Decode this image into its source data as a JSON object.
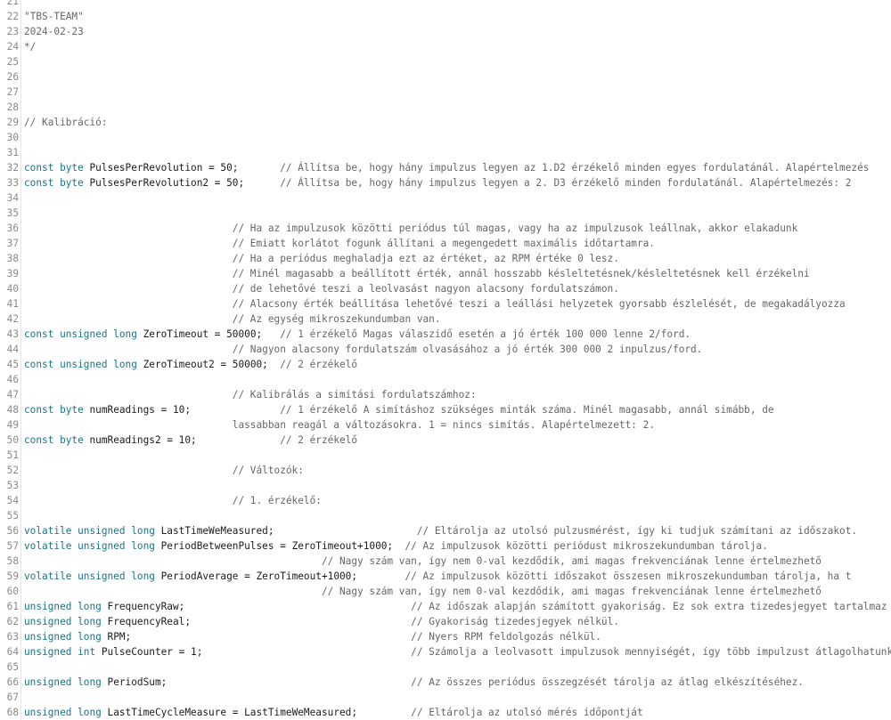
{
  "editor": {
    "lines": [
      {
        "n": "21",
        "segs": []
      },
      {
        "n": "22",
        "segs": [
          {
            "t": "cm",
            "v": "\"TBS-TEAM\""
          }
        ]
      },
      {
        "n": "23",
        "segs": [
          {
            "t": "cm",
            "v": "2024-02-23"
          }
        ]
      },
      {
        "n": "24",
        "segs": [
          {
            "t": "cm",
            "v": "*/"
          }
        ]
      },
      {
        "n": "25",
        "segs": []
      },
      {
        "n": "26",
        "segs": []
      },
      {
        "n": "27",
        "segs": []
      },
      {
        "n": "28",
        "segs": []
      },
      {
        "n": "29",
        "segs": [
          {
            "t": "cm",
            "v": "// Kalibráció:"
          }
        ]
      },
      {
        "n": "30",
        "segs": []
      },
      {
        "n": "31",
        "segs": []
      },
      {
        "n": "32",
        "segs": [
          {
            "t": "kw",
            "v": "const byte "
          },
          {
            "t": "id",
            "v": "PulsesPerRevolution = 50;       "
          },
          {
            "t": "cm",
            "v": "// Állítsa be, hogy hány impulzus legyen az 1.D2 érzékelő minden egyes fordulatánál. Alapértelmezés"
          }
        ]
      },
      {
        "n": "33",
        "segs": [
          {
            "t": "kw",
            "v": "const byte "
          },
          {
            "t": "id",
            "v": "PulsesPerRevolution2 = 50;      "
          },
          {
            "t": "cm",
            "v": "// Állítsa be, hogy hány impulzus legyen a 2. D3 érzékelő minden fordulatánál. Alapértelmezés: 2"
          }
        ]
      },
      {
        "n": "34",
        "segs": []
      },
      {
        "n": "35",
        "segs": []
      },
      {
        "n": "36",
        "segs": [
          {
            "t": "id",
            "v": "                                   "
          },
          {
            "t": "cm",
            "v": "// Ha az impulzusok közötti periódus túl magas, vagy ha az impulzusok leállnak, akkor elakadunk"
          }
        ]
      },
      {
        "n": "37",
        "segs": [
          {
            "t": "id",
            "v": "                                   "
          },
          {
            "t": "cm",
            "v": "// Emiatt korlátot fogunk állítani a megengedett maximális időtartamra."
          }
        ]
      },
      {
        "n": "38",
        "segs": [
          {
            "t": "id",
            "v": "                                   "
          },
          {
            "t": "cm",
            "v": "// Ha a periódus meghaladja ezt az értéket, az RPM értéke 0 lesz."
          }
        ]
      },
      {
        "n": "39",
        "segs": [
          {
            "t": "id",
            "v": "                                   "
          },
          {
            "t": "cm",
            "v": "// Minél magasabb a beállított érték, annál hosszabb késleltetésnek/késleltetésnek kell érzékelni"
          }
        ]
      },
      {
        "n": "40",
        "segs": [
          {
            "t": "id",
            "v": "                                   "
          },
          {
            "t": "cm",
            "v": "// de lehetővé teszi a leolvasást nagyon alacsony fordulatszámon."
          }
        ]
      },
      {
        "n": "41",
        "segs": [
          {
            "t": "id",
            "v": "                                   "
          },
          {
            "t": "cm",
            "v": "// Alacsony érték beállítása lehetővé teszi a leállási helyzetek gyorsabb észlelését, de megakadályozza"
          }
        ]
      },
      {
        "n": "42",
        "segs": [
          {
            "t": "id",
            "v": "                                   "
          },
          {
            "t": "cm",
            "v": "// Az egység mikroszekundumban van."
          }
        ]
      },
      {
        "n": "43",
        "segs": [
          {
            "t": "kw",
            "v": "const unsigned long "
          },
          {
            "t": "id",
            "v": "ZeroTimeout = 50000;   "
          },
          {
            "t": "cm",
            "v": "// 1 érzékelő Magas válaszidő esetén a jó érték 100 000 lenne 2/ford."
          }
        ]
      },
      {
        "n": "44",
        "segs": [
          {
            "t": "id",
            "v": "                                   "
          },
          {
            "t": "cm",
            "v": "// Nagyon alacsony fordulatszám olvasásához a jó érték 300 000 2 inpulzus/ford."
          }
        ]
      },
      {
        "n": "45",
        "segs": [
          {
            "t": "kw",
            "v": "const unsigned long "
          },
          {
            "t": "id",
            "v": "ZeroTimeout2 = 50000;  "
          },
          {
            "t": "cm",
            "v": "// 2 érzékelő"
          }
        ]
      },
      {
        "n": "46",
        "segs": []
      },
      {
        "n": "47",
        "segs": [
          {
            "t": "id",
            "v": "                                   "
          },
          {
            "t": "cm",
            "v": "// Kalibrálás a simítási fordulatszámhoz:"
          }
        ]
      },
      {
        "n": "48",
        "segs": [
          {
            "t": "kw",
            "v": "const byte "
          },
          {
            "t": "id",
            "v": "numReadings = 10;               "
          },
          {
            "t": "cm",
            "v": "// 1 érzékelő A simításhoz szükséges minták száma. Minél magasabb, annál simább, de"
          }
        ]
      },
      {
        "n": "49",
        "segs": [
          {
            "t": "id",
            "v": "                                   "
          },
          {
            "t": "cm",
            "v": "lassabban reagál a változásokra. 1 = nincs simítás. Alapértelmezett: 2."
          }
        ]
      },
      {
        "n": "50",
        "segs": [
          {
            "t": "kw",
            "v": "const byte "
          },
          {
            "t": "id",
            "v": "numReadings2 = 10;              "
          },
          {
            "t": "cm",
            "v": "// 2 érzékelő"
          }
        ]
      },
      {
        "n": "51",
        "segs": []
      },
      {
        "n": "52",
        "segs": [
          {
            "t": "id",
            "v": "                                   "
          },
          {
            "t": "cm",
            "v": "// Változók:"
          }
        ]
      },
      {
        "n": "53",
        "segs": []
      },
      {
        "n": "54",
        "segs": [
          {
            "t": "id",
            "v": "                                   "
          },
          {
            "t": "cm",
            "v": "// 1. érzékelő:"
          }
        ]
      },
      {
        "n": "55",
        "segs": []
      },
      {
        "n": "56",
        "segs": [
          {
            "t": "kw",
            "v": "volatile unsigned long "
          },
          {
            "t": "id",
            "v": "LastTimeWeMeasured;                        "
          },
          {
            "t": "cm",
            "v": "// Eltárolja az utolsó pulzusmérést, így ki tudjuk számítani az időszakot."
          }
        ]
      },
      {
        "n": "57",
        "segs": [
          {
            "t": "kw",
            "v": "volatile unsigned long "
          },
          {
            "t": "id",
            "v": "PeriodBetweenPulses = ZeroTimeout+1000;  "
          },
          {
            "t": "cm",
            "v": "// Az impulzusok közötti periódust mikroszekundumban tárolja."
          }
        ]
      },
      {
        "n": "58",
        "segs": [
          {
            "t": "id",
            "v": "                                                  "
          },
          {
            "t": "cm",
            "v": "// Nagy szám van, így nem 0-val kezdődik, ami magas frekvenciának lenne értelmezhető"
          }
        ]
      },
      {
        "n": "59",
        "segs": [
          {
            "t": "kw",
            "v": "volatile unsigned long "
          },
          {
            "t": "id",
            "v": "PeriodAverage = ZeroTimeout+1000;        "
          },
          {
            "t": "cm",
            "v": "// Az impulzusok közötti időszakot összesen mikroszekundumban tárolja, ha t"
          }
        ]
      },
      {
        "n": "60",
        "segs": [
          {
            "t": "id",
            "v": "                                                  "
          },
          {
            "t": "cm",
            "v": "// Nagy szám van, így nem 0-val kezdődik, ami magas frekvenciának lenne értelmezhető"
          }
        ]
      },
      {
        "n": "61",
        "segs": [
          {
            "t": "kw",
            "v": "unsigned long "
          },
          {
            "t": "id",
            "v": "FrequencyRaw;                                      "
          },
          {
            "t": "cm",
            "v": "// Az időszak alapján számított gyakoriság. Ez sok extra tizedesjegyet tartalmaz"
          }
        ]
      },
      {
        "n": "62",
        "segs": [
          {
            "t": "kw",
            "v": "unsigned long "
          },
          {
            "t": "id",
            "v": "FrequencyReal;                                     "
          },
          {
            "t": "cm",
            "v": "// Gyakoriság tizedesjegyek nélkül."
          }
        ]
      },
      {
        "n": "63",
        "segs": [
          {
            "t": "kw",
            "v": "unsigned long "
          },
          {
            "t": "id",
            "v": "RPM;                                               "
          },
          {
            "t": "cm",
            "v": "// Nyers RPM feldolgozás nélkül."
          }
        ]
      },
      {
        "n": "64",
        "segs": [
          {
            "t": "kw",
            "v": "unsigned int "
          },
          {
            "t": "id",
            "v": "PulseCounter = 1;                                   "
          },
          {
            "t": "cm",
            "v": "// Számolja a leolvasott impulzusok mennyiségét, így több impulzust átlagolhatunk"
          }
        ]
      },
      {
        "n": "65",
        "segs": []
      },
      {
        "n": "66",
        "segs": [
          {
            "t": "kw",
            "v": "unsigned long "
          },
          {
            "t": "id",
            "v": "PeriodSum;                                         "
          },
          {
            "t": "cm",
            "v": "// Az összes periódus összegzését tárolja az átlag elkészítéséhez."
          }
        ]
      },
      {
        "n": "67",
        "segs": []
      },
      {
        "n": "68",
        "segs": [
          {
            "t": "kw",
            "v": "unsigned long "
          },
          {
            "t": "id",
            "v": "LastTimeCycleMeasure = LastTimeWeMeasured;         "
          },
          {
            "t": "cm",
            "v": "// Eltárolja az utolsó mérés időpontját"
          }
        ]
      }
    ]
  }
}
